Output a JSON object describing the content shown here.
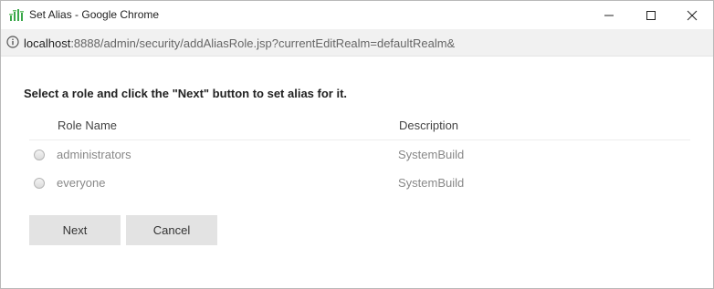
{
  "window": {
    "title": "Set Alias - Google Chrome",
    "icon": "app-bars-icon"
  },
  "address": {
    "host": "localhost",
    "rest": ":8888/admin/security/addAliasRole.jsp?currentEditRealm=defaultRealm&"
  },
  "page": {
    "instruction": "Select a role and click the \"Next\" button to set alias for it.",
    "columns": {
      "name": "Role Name",
      "description": "Description"
    },
    "rows": [
      {
        "name": "administrators",
        "description": "SystemBuild"
      },
      {
        "name": "everyone",
        "description": "SystemBuild"
      }
    ],
    "buttons": {
      "next": "Next",
      "cancel": "Cancel"
    }
  },
  "colors": {
    "button_bg": "#e3e3e3",
    "icon_green": "#3aa84a"
  }
}
